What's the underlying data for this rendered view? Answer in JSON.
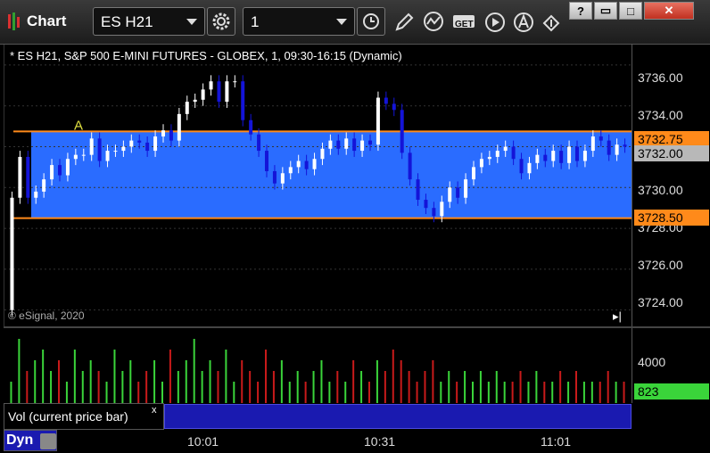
{
  "window": {
    "title": "Chart",
    "symbol": "ES H21",
    "interval": "1",
    "buttons": {
      "minimize": "?",
      "restore": "▭",
      "maximize": "□",
      "close": "✕"
    },
    "get_label": "GET"
  },
  "chart": {
    "header": "* ES H21, S&P 500 E-MINI FUTURES - GLOBEX, 1, 09:30-16:15 (Dynamic)",
    "copyright": "© eSignal, 2020",
    "scroll_icon": "▸|",
    "annotation": "A",
    "y_ticks": [
      "3736.00",
      "3734.00",
      "3732.00",
      "3730.00",
      "3728.00",
      "3726.00",
      "3724.00"
    ],
    "upper_line": "3732.75",
    "lower_line": "3728.50",
    "last_price": "3732.00",
    "colors": {
      "band": "#2a6cff",
      "line": "#ff8a1a",
      "up": "#ffffff",
      "down": "#1414d8",
      "vol_up": "#3ad43a",
      "vol_down": "#c81a1a",
      "last_tag": "#b8b8b8"
    }
  },
  "chart_data": {
    "type": "candlestick",
    "ylim": [
      3723.2,
      3737.0
    ],
    "opens": [
      3724.0,
      3729.5,
      3731.5,
      3729.5,
      3729.8,
      3730.4,
      3731.1,
      3730.6,
      3731.4,
      3731.6,
      3731.6,
      3732.4,
      3731.3,
      3731.8,
      3731.8,
      3732.0,
      3732.3,
      3732.2,
      3731.8,
      3732.5,
      3732.8,
      3732.3,
      3733.6,
      3734.2,
      3734.3,
      3734.8,
      3735.2,
      3734.2,
      3735.2,
      3735.2,
      3733.3,
      3732.6,
      3731.8,
      3730.8,
      3730.2,
      3730.7,
      3731.0,
      3731.3,
      3730.9,
      3731.4,
      3731.9,
      3732.3,
      3731.9,
      3732.4,
      3731.8,
      3732.3,
      3732.1,
      3734.4,
      3734.1,
      3733.8,
      3731.7,
      3730.4,
      3729.4,
      3729.0,
      3728.6,
      3729.3,
      3730.0,
      3729.5,
      3730.4,
      3731.0,
      3731.4,
      3731.5,
      3731.8,
      3732.0,
      3731.4,
      3730.7,
      3731.2,
      3731.6,
      3731.3,
      3731.8,
      3731.2,
      3732.0,
      3731.3,
      3731.8,
      3732.5,
      3732.3,
      3731.6,
      3732.1
    ],
    "closes": [
      3729.5,
      3731.5,
      3729.5,
      3729.8,
      3730.4,
      3731.1,
      3730.6,
      3731.4,
      3731.6,
      3731.6,
      3732.4,
      3731.3,
      3731.8,
      3731.8,
      3732.0,
      3732.3,
      3732.2,
      3731.8,
      3732.5,
      3732.8,
      3732.3,
      3733.6,
      3734.2,
      3734.3,
      3734.8,
      3735.2,
      3734.2,
      3735.2,
      3735.2,
      3733.3,
      3732.6,
      3731.8,
      3730.8,
      3730.2,
      3730.7,
      3731.0,
      3731.3,
      3730.9,
      3731.4,
      3731.9,
      3732.3,
      3731.9,
      3732.4,
      3731.8,
      3732.3,
      3732.1,
      3734.4,
      3734.1,
      3733.8,
      3731.7,
      3730.4,
      3729.4,
      3729.0,
      3728.6,
      3729.3,
      3730.0,
      3729.5,
      3730.4,
      3731.0,
      3731.4,
      3731.5,
      3731.8,
      3732.0,
      3731.4,
      3730.7,
      3731.2,
      3731.6,
      3731.3,
      3731.8,
      3731.2,
      3732.0,
      3731.3,
      3731.8,
      3732.5,
      3732.3,
      3731.6,
      3732.1,
      3732.0
    ],
    "volumes": [
      2,
      6,
      3,
      4,
      5,
      3,
      4,
      2,
      5,
      3,
      4,
      3,
      2,
      5,
      3,
      4,
      2,
      3,
      4,
      2,
      5,
      3,
      4,
      6,
      3,
      4,
      3,
      5,
      2,
      4,
      3,
      2,
      5,
      3,
      4,
      2,
      3,
      2,
      3,
      4,
      2,
      3,
      2,
      4,
      3,
      2,
      4,
      3,
      5,
      4,
      3,
      2,
      3,
      4,
      2,
      3,
      2,
      3,
      2,
      3,
      2,
      3,
      2,
      2,
      3,
      2,
      3,
      2,
      2,
      3,
      2,
      3,
      2,
      2,
      2,
      3,
      2,
      2
    ],
    "vol_ylim": [
      0,
      7
    ],
    "vol_tick": "4000",
    "vol_last": "823",
    "x_ticks": [
      "10:01",
      "10:31",
      "11:01"
    ]
  },
  "volume_pane": {
    "legend": "Vol (current price bar)",
    "close_icon": "x"
  },
  "footer": {
    "dyn_label": "Dyn"
  }
}
